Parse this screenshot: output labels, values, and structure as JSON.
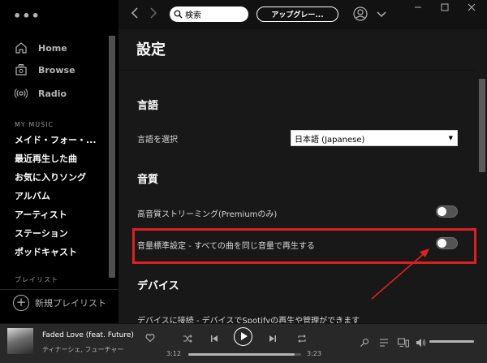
{
  "sidebar": {
    "nav": [
      {
        "label": "Home",
        "icon": "home-icon"
      },
      {
        "label": "Browse",
        "icon": "browse-icon"
      },
      {
        "label": "Radio",
        "icon": "radio-icon"
      }
    ],
    "my_music_label": "MY MUSIC",
    "library": [
      "メイド・フォー・...",
      "最近再生した曲",
      "お気に入りソング",
      "アルバム",
      "アーティスト",
      "ステーション",
      "ポッドキャスト"
    ],
    "playlist_label": "プレイリスト",
    "new_playlist": "新規プレイリスト"
  },
  "topbar": {
    "search_text": "検索",
    "upgrade_label": "アップグレー..."
  },
  "settings": {
    "title": "設定",
    "language_header": "言語",
    "language_row": "言語を選択",
    "language_value": "日本語 (Japanese)",
    "quality_header": "音質",
    "hq_streaming": "高音質ストリーミング(Premiumのみ)",
    "hq_streaming_on": false,
    "normalize": "音量標準設定 - すべての曲を同じ音量で再生する",
    "normalize_on": false,
    "devices_header": "デバイス",
    "devices_row": "デバイスに接続 - デバイスでSpotifyの再生や管理ができます"
  },
  "player": {
    "track_title": "Faded Love (feat. Future)",
    "track_artist": "ティナーシェ, フューチャー",
    "elapsed": "3:12",
    "duration": "3:23",
    "progress": 0.945,
    "volume": 1.0
  },
  "colors": {
    "highlight": "#e02020",
    "background": "#181818",
    "sidebar": "#000000"
  }
}
